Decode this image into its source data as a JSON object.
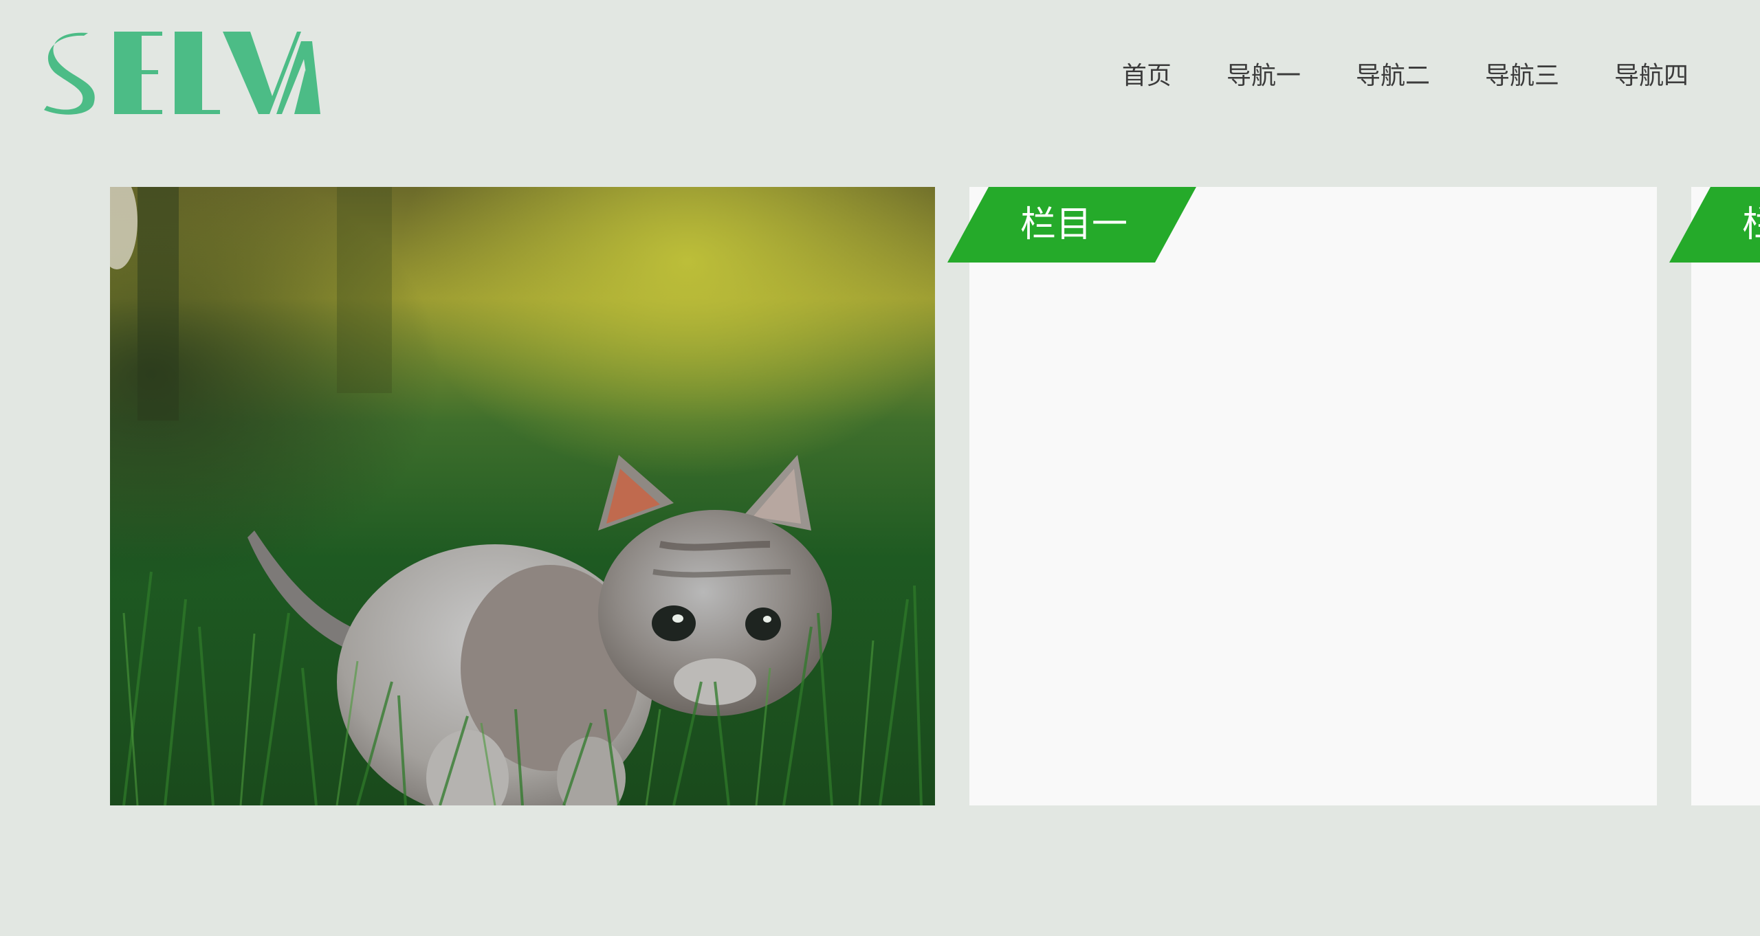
{
  "header": {
    "logo_text": "SELVA",
    "logo_color": "#4cbc86",
    "nav": [
      "首页",
      "导航一",
      "导航二",
      "导航三",
      "导航四"
    ]
  },
  "main": {
    "image_subject": "kitten-in-grass",
    "columns": [
      {
        "label": "栏目一"
      },
      {
        "label": "栏目一"
      }
    ],
    "accent_color": "#25aa2a"
  }
}
